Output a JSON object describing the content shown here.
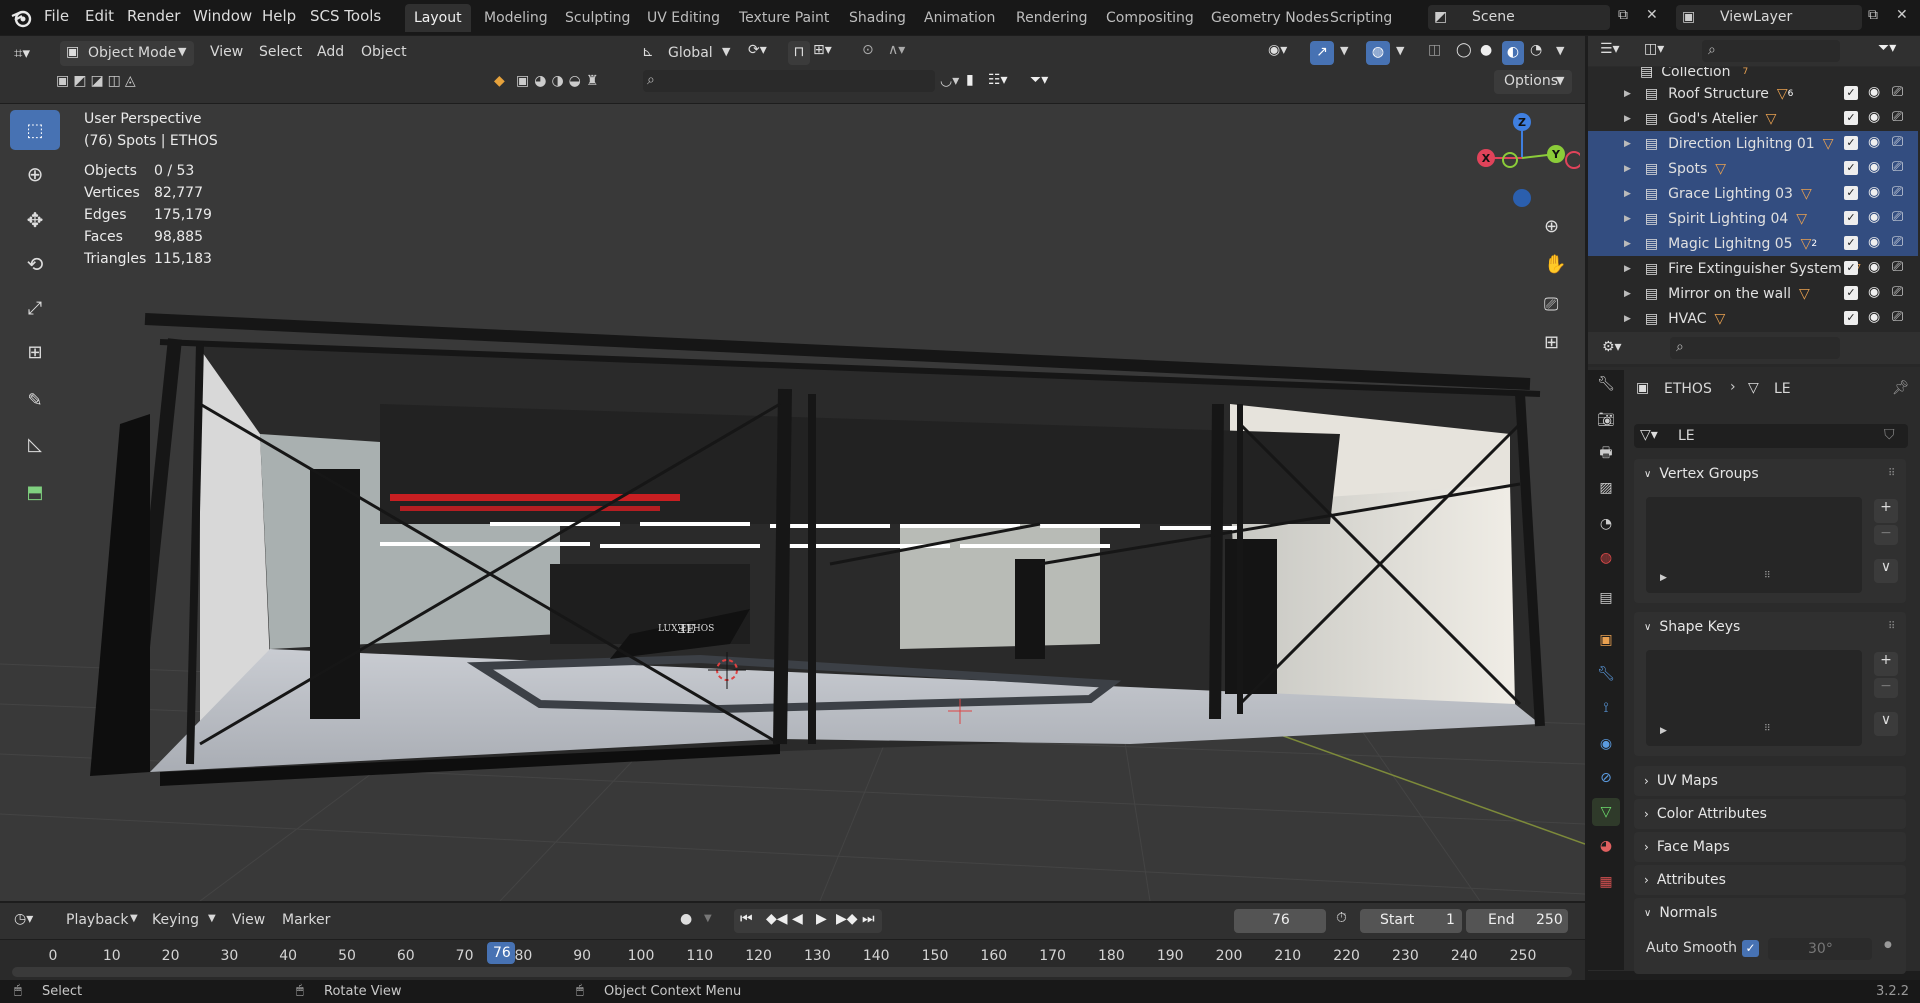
{
  "topbar": {
    "menus": [
      "File",
      "Edit",
      "Render",
      "Window",
      "Help",
      "SCS Tools"
    ],
    "workspaces": [
      "Layout",
      "Modeling",
      "Sculpting",
      "UV Editing",
      "Texture Paint",
      "Shading",
      "Animation",
      "Rendering",
      "Compositing",
      "Geometry Nodes",
      "Scripting"
    ],
    "active_workspace": "Layout",
    "scene": "Scene",
    "view_layer": "ViewLayer"
  },
  "viewport_header": {
    "mode": "Object Mode",
    "menus": [
      "View",
      "Select",
      "Add",
      "Object"
    ],
    "orientation": "Global",
    "options": "Options"
  },
  "viewport": {
    "perspective": "User Perspective",
    "context": "(76) Spots | ETHOS",
    "stats": [
      {
        "label": "Objects",
        "value": "0 / 53"
      },
      {
        "label": "Vertices",
        "value": "82,777"
      },
      {
        "label": "Edges",
        "value": "175,179"
      },
      {
        "label": "Faces",
        "value": "98,885"
      },
      {
        "label": "Triangles",
        "value": "115,183"
      }
    ],
    "logo_text": "LUX ETHOS",
    "gizmo": {
      "x": "X",
      "y": "Y",
      "z": "Z"
    }
  },
  "outliner": {
    "top_partial": "Collection",
    "top_partial_badge": "7",
    "items": [
      {
        "label": "Roof Structure",
        "selected": false,
        "badge": "6",
        "badge2": "2"
      },
      {
        "label": "God's Atelier",
        "selected": false,
        "badge": "",
        "badge2": ""
      },
      {
        "label": "Direction Lighitng 01",
        "selected": true,
        "badge": "",
        "badge2": ""
      },
      {
        "label": "Spots",
        "selected": true,
        "badge": "",
        "badge2": ""
      },
      {
        "label": "Grace Lighting 03",
        "selected": true,
        "badge": "",
        "badge2": ""
      },
      {
        "label": "Spirit Lighting 04",
        "selected": true,
        "badge": "",
        "badge2": ""
      },
      {
        "label": "Magic Lighitng 05",
        "selected": true,
        "badge": "2",
        "badge2": ""
      },
      {
        "label": "Fire Extinguisher System",
        "selected": false,
        "badge": "",
        "badge2": ""
      },
      {
        "label": "Mirror on the wall",
        "selected": false,
        "badge": "",
        "badge2": ""
      },
      {
        "label": "HVAC",
        "selected": false,
        "badge": "",
        "badge2": ""
      }
    ]
  },
  "properties": {
    "breadcrumb_object": "ETHOS",
    "breadcrumb_data": "LE",
    "mesh_name": "LE",
    "panels": [
      "Vertex Groups",
      "Shape Keys",
      "UV Maps",
      "Color Attributes",
      "Face Maps",
      "Attributes",
      "Normals"
    ],
    "auto_smooth_label": "Auto Smooth",
    "auto_smooth_angle": "30°",
    "auto_smooth_checked": true
  },
  "timeline": {
    "menus": [
      "Playback",
      "Keying",
      "View",
      "Marker"
    ],
    "current_frame": "76",
    "start_label": "Start",
    "start": "1",
    "end_label": "End",
    "end": "250",
    "ticks": [
      "0",
      "10",
      "20",
      "30",
      "40",
      "50",
      "60",
      "70",
      "80",
      "90",
      "100",
      "110",
      "120",
      "130",
      "140",
      "150",
      "160",
      "170",
      "180",
      "190",
      "200",
      "210",
      "220",
      "230",
      "240",
      "250"
    ]
  },
  "statusbar": {
    "select": "Select",
    "rotate": "Rotate View",
    "context_menu": "Object Context Menu",
    "version": "3.2.2"
  },
  "colors": {
    "accent": "#4772b3",
    "selected_row": "#334d80",
    "x_axis": "#e0435a",
    "y_axis": "#8bcc39",
    "z_axis": "#3f7fe0"
  }
}
